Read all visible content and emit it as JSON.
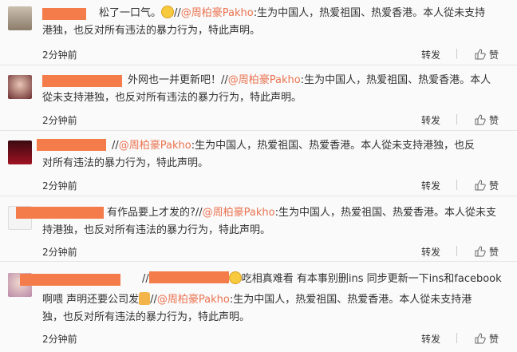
{
  "comments": [
    {
      "line1_prefix": "松了一口气。",
      "line1_after_emoji": "//",
      "mention": "@周柏豪Pakho",
      "line1_rest": ":生为中国人，热爱祖国、热爱香港。本人從未支持",
      "line2": "港独，也反对所有违法的暴力行为，特此声明。",
      "time": "2分钟前",
      "repost": "转发",
      "like": "赞"
    },
    {
      "line1_prefix": "外网也一并更新吧！//",
      "mention": "@周柏豪Pakho",
      "line1_rest": ":生为中国人，热爱祖国、热爱香港。本人",
      "line2": "從未支持港独，也反对所有违法的暴力行为，特此声明。",
      "time": "2分钟前",
      "repost": "转发",
      "like": "赞"
    },
    {
      "line1_prefix": "//",
      "mention": "@周柏豪Pakho",
      "line1_rest": ":生为中国人，热爱祖国、热爱香港。本人從未支持港独，也反",
      "line2": "对所有违法的暴力行为，特此声明。",
      "time": "2分钟前",
      "repost": "转发",
      "like": "赞"
    },
    {
      "line1_prefix": "有作品要上才发的?//",
      "mention": "@周柏豪Pakho",
      "line1_rest": ":生为中国人，热爱祖国、热爱香港。本人從未支",
      "line2": "持港独，也反对所有违法的暴力行为，特此声明。",
      "time": "2分钟前",
      "repost": "转发",
      "like": "赞"
    },
    {
      "line1_prefix": "//",
      "line1_after_redact": "吃相真难看 有本事别删ins 同步更新一下ins和facebook",
      "line2_prefix": "啊喂 声明还要公司发",
      "line2_after_emoji": "//",
      "mention": "@周柏豪Pakho",
      "line2_rest": ":生为中国人，热爱祖国、热爱香港。本人從未支持港",
      "line3": "独，也反对所有违法的暴力行为，特此声明。",
      "time": "2分钟前",
      "repost": "转发",
      "like": "赞"
    }
  ],
  "colors": {
    "mention": "#eb7350",
    "redaction": "#f47c4a",
    "text": "#333333",
    "divider": "#e6e6e6"
  },
  "icons": {
    "like": "thumbs-up-icon",
    "emoji_crying": "crying-face-icon",
    "emoji_thumb": "thumbs-up-emoji-icon",
    "emoji_grin": "grinning-face-icon"
  }
}
